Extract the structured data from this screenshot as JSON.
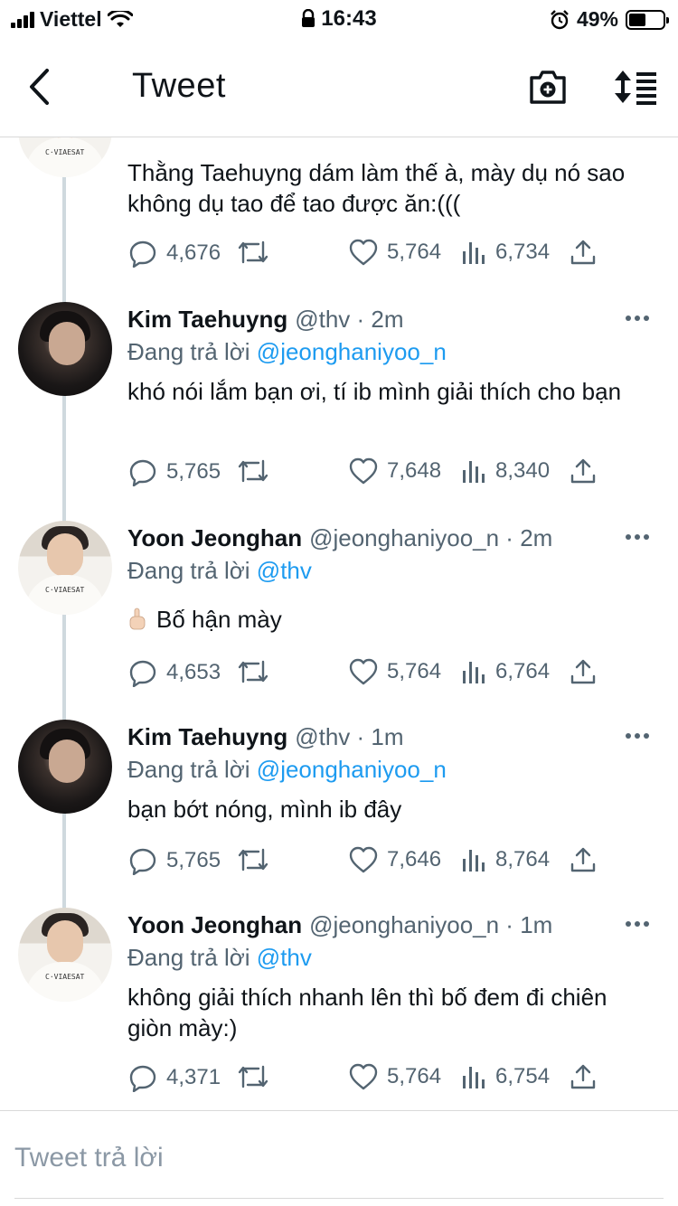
{
  "status_bar": {
    "carrier": "Viettel",
    "time": "16:43",
    "battery": "49%",
    "battery_level": 0.49
  },
  "header": {
    "title": "Tweet"
  },
  "top_partial": {
    "text": "Thằng Taehuyng dám làm thế à, mày dụ nó sao không dụ tao để tao được ăn:(((",
    "stats": {
      "replies": "4,676",
      "likes": "5,764",
      "views": "6,734"
    }
  },
  "tweets": [
    {
      "name": "Kim Taehuyng",
      "meta": "@thv · 2m",
      "reply_prefix": "Đang trả lời",
      "reply_to": "@jeonghaniyoo_n",
      "text": "khó nói lắm bạn ơi, tí ib mình giải thích cho bạn",
      "stats": {
        "replies": "5,765",
        "likes": "7,648",
        "views": "8,340"
      }
    },
    {
      "name": "Yoon Jeonghan",
      "meta": "@jeonghaniyoo_n · 2m",
      "reply_prefix": "Đang trả lời",
      "reply_to": "@thv",
      "text": "Bố hận mày",
      "stats": {
        "replies": "4,653",
        "likes": "5,764",
        "views": "6,764"
      }
    },
    {
      "name": "Kim Taehuyng",
      "meta": "@thv · 1m",
      "reply_prefix": "Đang trả lời",
      "reply_to": "@jeonghaniyoo_n",
      "text": "bạn bớt nóng, mình ib đây",
      "stats": {
        "replies": "5,765",
        "likes": "7,646",
        "views": "8,764"
      }
    },
    {
      "name": "Yoon Jeonghan",
      "meta": "@jeonghaniyoo_n · 1m",
      "reply_prefix": "Đang trả lời",
      "reply_to": "@thv",
      "text": "không giải thích nhanh lên thì bố đem đi chiên giòn mày:)",
      "stats": {
        "replies": "4,371",
        "likes": "5,764",
        "views": "6,754"
      }
    }
  ],
  "reply_bar": {
    "placeholder": "Tweet trả lời"
  },
  "colors": {
    "accent": "#1d9bf0",
    "secondary_text": "#536471",
    "primary_text": "#0f1419"
  }
}
